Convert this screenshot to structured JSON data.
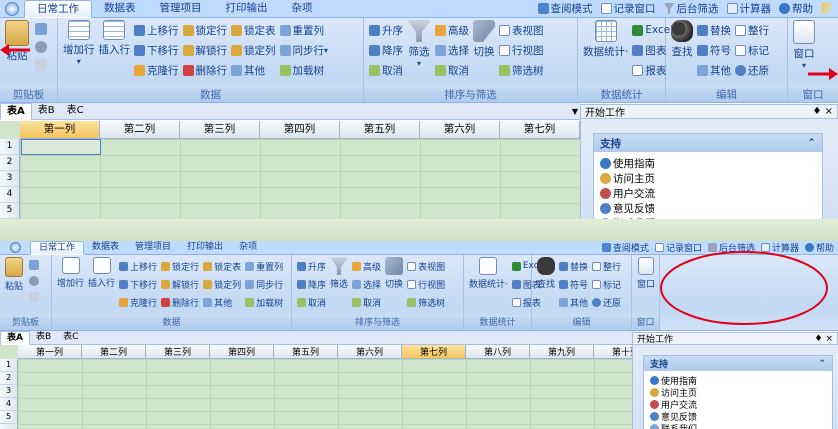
{
  "tabs": [
    "日常工作",
    "数据表",
    "管理项目",
    "打印输出",
    "杂项"
  ],
  "quick_tools": [
    "查阅模式",
    "记录窗口",
    "后台筛选",
    "计算器",
    "帮助"
  ],
  "groups": {
    "clipboard": {
      "label": "剪贴板",
      "paste": "粘贴"
    },
    "data": {
      "label": "数据",
      "add_row": "增加行",
      "insert_row": "插入行",
      "move_up": "上移行",
      "move_down": "下移行",
      "clone_row": "克隆行",
      "lock_row": "锁定行",
      "unlock_row": "解锁行",
      "delete_row": "删除行",
      "lock_table": "锁定表",
      "lock_col": "锁定列",
      "other": "其他",
      "dup_col": "重置列",
      "sync_col": "同步行",
      "load_tree": "加载树"
    },
    "sort": {
      "label": "排序与筛选",
      "asc": "升序",
      "desc": "降序",
      "cancel": "取消",
      "filter": "筛选",
      "advanced": "高级",
      "select": "选择",
      "cancel2": "取消",
      "switch": "切换",
      "table_view": "表视图",
      "row_view": "行视图",
      "filter_tree": "筛选树"
    },
    "stats": {
      "label": "数据统计",
      "stats": "数据统计·",
      "excel": "Excel",
      "chart": "图表",
      "report": "报表"
    },
    "edit": {
      "label": "编辑",
      "find": "查找",
      "replace": "替换",
      "symbol": "符号",
      "other": "其他",
      "tidy": "整行",
      "mark": "标记",
      "restore": "还原"
    },
    "window": {
      "label": "窗口",
      "window": "窗口"
    }
  },
  "sheets": [
    "表A",
    "表B",
    "表C"
  ],
  "columns_top": [
    "第一列",
    "第二列",
    "第三列",
    "第四列",
    "第五列",
    "第六列",
    "第七列"
  ],
  "columns_bottom": [
    "第一列",
    "第二列",
    "第三列",
    "第四列",
    "第五列",
    "第六列",
    "第七列",
    "第八列",
    "第九列",
    "第十列"
  ],
  "rows": [
    "1",
    "2",
    "3",
    "4",
    "5"
  ],
  "panel": {
    "title": "开始工作",
    "pin": "♦ ×",
    "support": "支持",
    "items": [
      "使用指南",
      "访问主页",
      "用户交流",
      "意见反馈",
      "联系我们"
    ]
  },
  "colors": {
    "accent": "#15428b",
    "ribbon": "#c2d8f3",
    "grid": "#cfe6cc",
    "highlight_circle": "#e0001a",
    "arrow": "#e0001a"
  }
}
